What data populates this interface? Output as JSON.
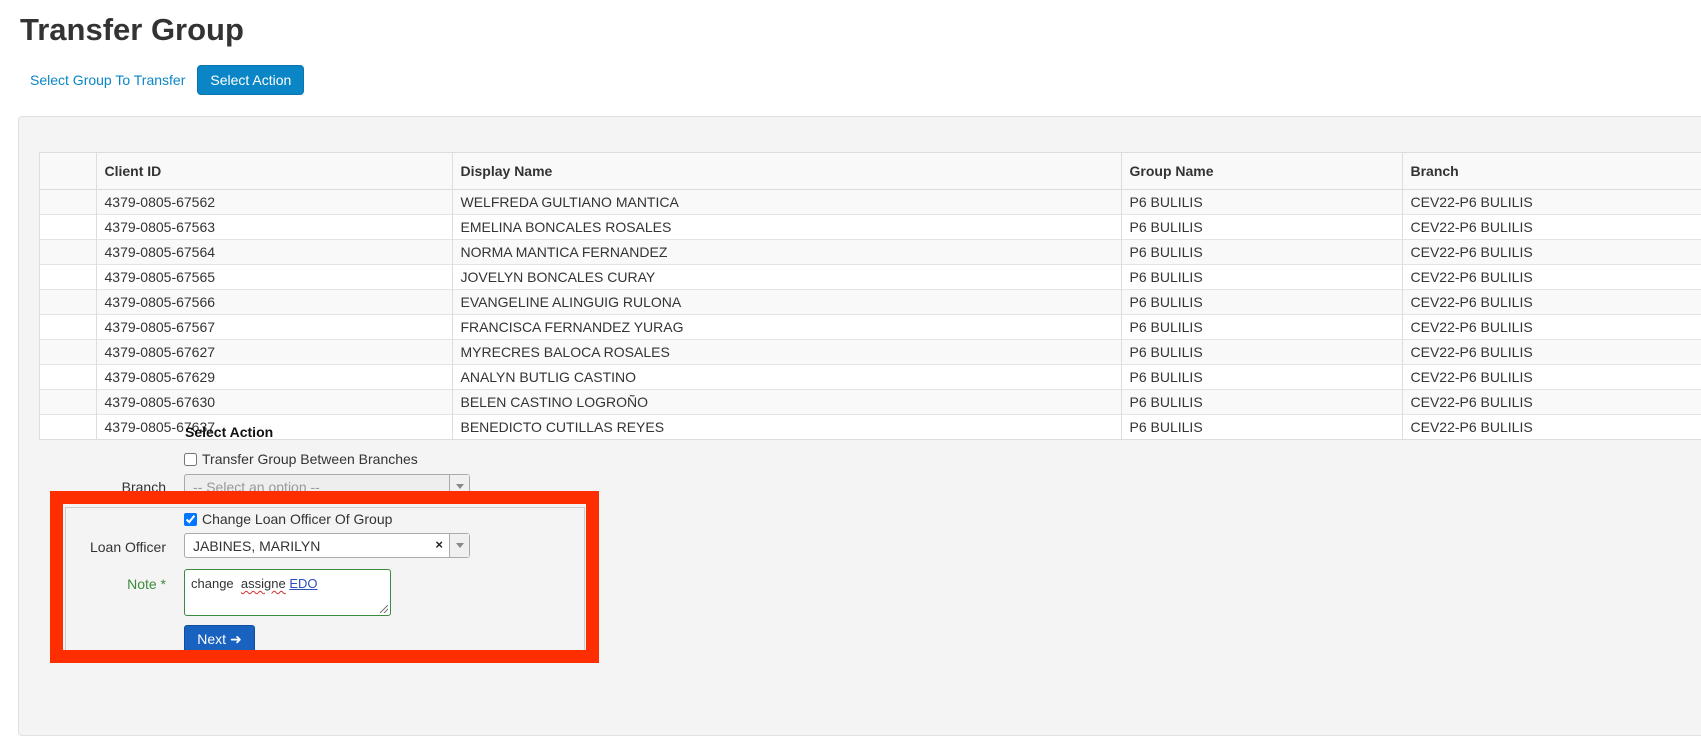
{
  "page": {
    "title": "Transfer Group"
  },
  "steps": {
    "step1": "Select Group To Transfer",
    "step2": "Select Action"
  },
  "table": {
    "columns": [
      "",
      "Client ID",
      "Display Name",
      "Group Name",
      "Branch"
    ],
    "rows": [
      [
        "4379-0805-67562",
        "WELFREDA GULTIANO MANTICA",
        "P6 BULILIS",
        "CEV22-P6 BULILIS"
      ],
      [
        "4379-0805-67563",
        "EMELINA BONCALES ROSALES",
        "P6 BULILIS",
        "CEV22-P6 BULILIS"
      ],
      [
        "4379-0805-67564",
        "NORMA MANTICA FERNANDEZ",
        "P6 BULILIS",
        "CEV22-P6 BULILIS"
      ],
      [
        "4379-0805-67565",
        "JOVELYN BONCALES CURAY",
        "P6 BULILIS",
        "CEV22-P6 BULILIS"
      ],
      [
        "4379-0805-67566",
        "EVANGELINE ALINGUIG RULONA",
        "P6 BULILIS",
        "CEV22-P6 BULILIS"
      ],
      [
        "4379-0805-67567",
        "FRANCISCA FERNANDEZ YURAG",
        "P6 BULILIS",
        "CEV22-P6 BULILIS"
      ],
      [
        "4379-0805-67627",
        "MYRECRES BALOCA ROSALES",
        "P6 BULILIS",
        "CEV22-P6 BULILIS"
      ],
      [
        "4379-0805-67629",
        "ANALYN BUTLIG CASTINO",
        "P6 BULILIS",
        "CEV22-P6 BULILIS"
      ],
      [
        "4379-0805-67630",
        "BELEN CASTINO LOGROÑO",
        "P6 BULILIS",
        "CEV22-P6 BULILIS"
      ],
      [
        "4379-0805-67637",
        "BENEDICTO CUTILLAS REYES",
        "P6 BULILIS",
        "CEV22-P6 BULILIS"
      ]
    ]
  },
  "form": {
    "section_title": "Select Action",
    "transfer_branches": {
      "label": "Transfer Group Between Branches",
      "checked": false
    },
    "branch": {
      "label": "Branch",
      "placeholder": "-- Select an option --"
    },
    "change_officer": {
      "label": "Change Loan Officer Of Group",
      "checked": true
    },
    "loan_officer": {
      "label": "Loan Officer",
      "value": "JABINES, MARILYN",
      "clear_symbol": "×"
    },
    "note": {
      "label": "Note *",
      "word1": "change",
      "word2": "assigne",
      "word3": "EDO"
    },
    "next": {
      "label": "Next",
      "arrow": "➜"
    }
  },
  "colors": {
    "accent": "#0a86c7",
    "highlight": "#ff2e00",
    "required": "#3c8b3c"
  }
}
